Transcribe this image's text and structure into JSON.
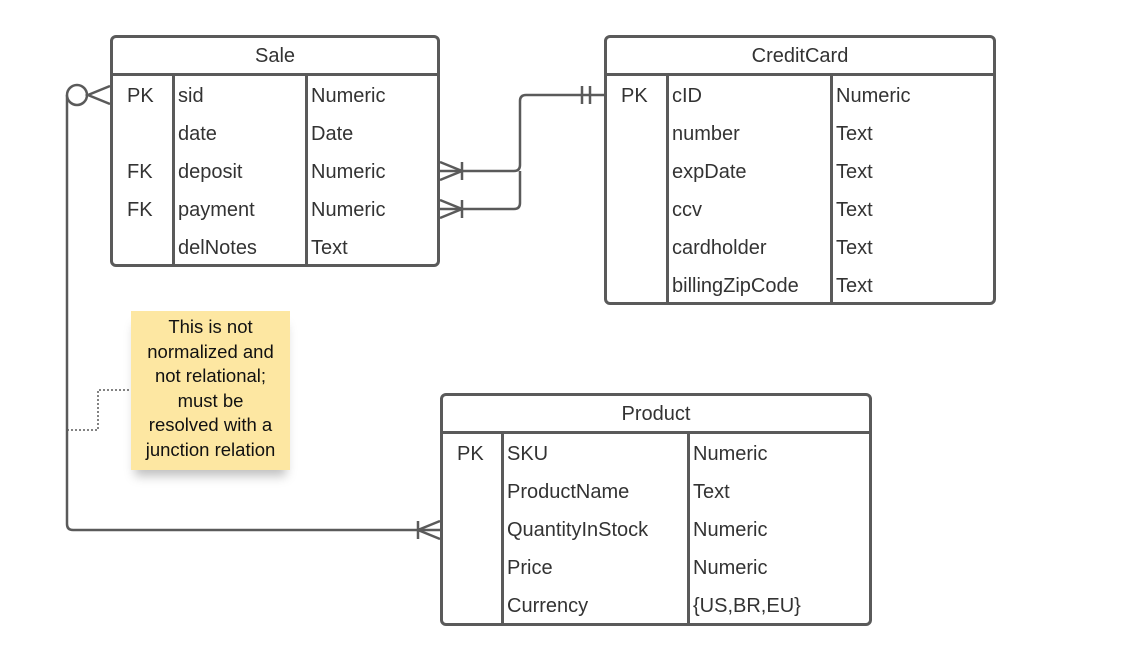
{
  "entities": [
    {
      "id": "sale",
      "title": "Sale",
      "rows": [
        {
          "key": "PK",
          "name": "sid",
          "type": "Numeric"
        },
        {
          "key": "",
          "name": "date",
          "type": "Date"
        },
        {
          "key": "FK",
          "name": "deposit",
          "type": "Numeric"
        },
        {
          "key": "FK",
          "name": "payment",
          "type": "Numeric"
        },
        {
          "key": "",
          "name": "delNotes",
          "type": "Text"
        }
      ]
    },
    {
      "id": "creditcard",
      "title": "CreditCard",
      "rows": [
        {
          "key": "PK",
          "name": "cID",
          "type": "Numeric"
        },
        {
          "key": "",
          "name": "number",
          "type": "Text"
        },
        {
          "key": "",
          "name": "expDate",
          "type": "Text"
        },
        {
          "key": "",
          "name": "ccv",
          "type": "Text"
        },
        {
          "key": "",
          "name": "cardholder",
          "type": "Text"
        },
        {
          "key": "",
          "name": "billingZipCode",
          "type": "Text"
        }
      ]
    },
    {
      "id": "product",
      "title": "Product",
      "rows": [
        {
          "key": "PK",
          "name": "SKU",
          "type": "Numeric"
        },
        {
          "key": "",
          "name": "ProductName",
          "type": "Text"
        },
        {
          "key": "",
          "name": "QuantityInStock",
          "type": "Numeric"
        },
        {
          "key": "",
          "name": "Price",
          "type": "Numeric"
        },
        {
          "key": "",
          "name": "Currency",
          "type": "{US,BR,EU}"
        }
      ]
    }
  ],
  "note": {
    "lines": [
      "This is not",
      "normalized and",
      "not relational;",
      "must be",
      "resolved with a",
      "junction relation"
    ],
    "color": "#fde7a2"
  },
  "relationships": [
    {
      "from": "Sale.deposit",
      "to": "CreditCard.cID",
      "from_card": "one-or-many",
      "to_card": "exactly-one"
    },
    {
      "from": "Sale.payment",
      "to": "CreditCard.cID",
      "from_card": "one-or-many",
      "to_card": "exactly-one"
    },
    {
      "from": "Sale.sid",
      "to": "Product",
      "from_card": "zero-or-many",
      "to_card": "one-or-many"
    }
  ],
  "colors": {
    "line": "#5a5a5a",
    "note": "#fde7a2"
  }
}
